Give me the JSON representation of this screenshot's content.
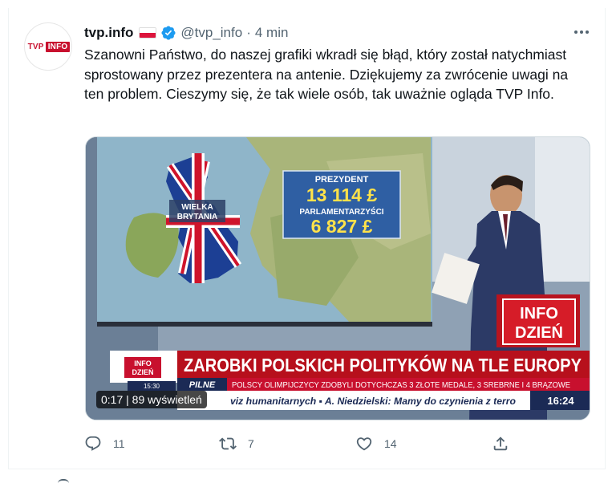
{
  "tweet": {
    "author_name": "tvp.info",
    "handle": "@tvp_info",
    "separator": "·",
    "time": "4 min",
    "avatar_logo_left": "TVP",
    "avatar_logo_right": "INFO",
    "text": "Szanowni Państwo, do naszej grafiki wkradł się błąd, który został natychmiast sprostowany przez prezentera na antenie. Dziękujemy za zwrócenie uwagi na ten problem. Cieszymy się, że tak wiele osób, tak uważnie ogląda TVP Info."
  },
  "video": {
    "map_label_line1": "WIELKA",
    "map_label_line2": "BRYTANIA",
    "box_title1": "PREZYDENT",
    "box_value1": "13 114 £",
    "box_title2": "PARLAMENTARZYŚCI",
    "box_value2": "6 827 £",
    "logo_line1": "INFO",
    "logo_line2": "DZIEŃ",
    "small_logo_line1": "INFO",
    "small_logo_line2": "DZIEŃ",
    "small_logo_time": "15:30",
    "headline": "ZAROBKI POLSKICH POLITYKÓW NA TLE EUROPY",
    "pilne": "PILNE",
    "ticker_top": "POLSCY OLIMPIJCZYCY ZDOBYLI DOTYCHCZAS 3 ZŁOTE MEDALE, 3 SREBRNE I 4 BRĄZOWE",
    "ticker_bottom": "viz humanitarnych  ▪ A. Niedzielski: Mamy do czynienia z terro",
    "clock": "16:24",
    "timer": "0:17 | 89 wyświetleń"
  },
  "actions": {
    "replies": "11",
    "retweets": "7",
    "likes": "14"
  },
  "colors": {
    "verified": "#1d9bf0",
    "tvp_red": "#c8102e",
    "secondary_text": "#536471"
  }
}
